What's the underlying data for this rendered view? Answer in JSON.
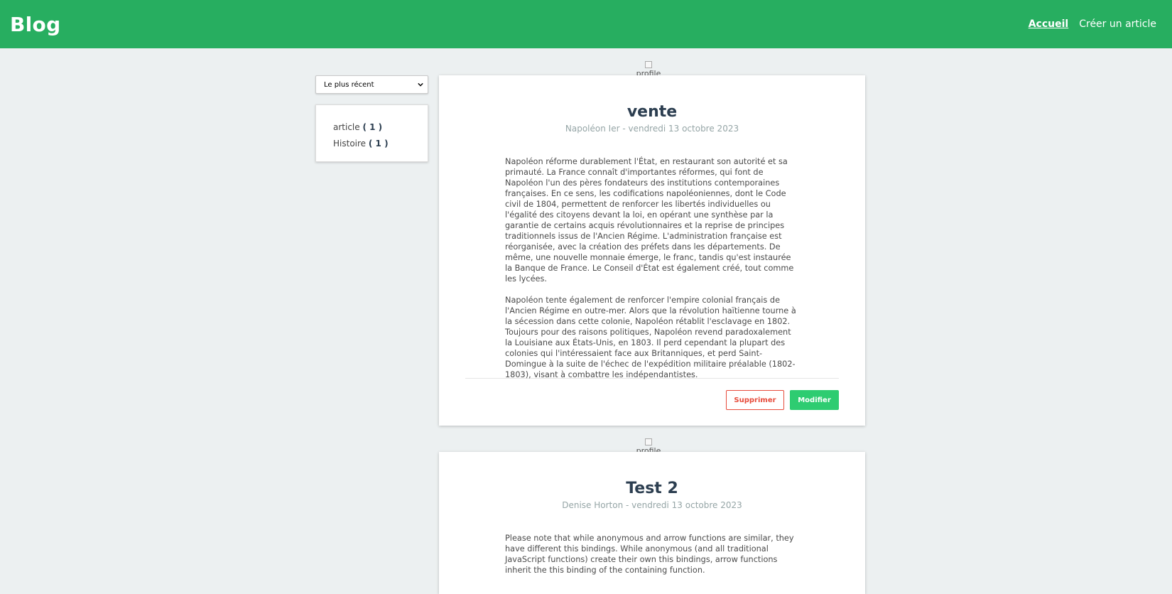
{
  "header": {
    "brand": "Blog",
    "nav": [
      {
        "label": "Accueil"
      },
      {
        "label": "Créer un article"
      }
    ]
  },
  "sort": {
    "selected": "Le plus récent"
  },
  "categories": [
    {
      "name": "article",
      "count": "( 1 )"
    },
    {
      "name": "Histoire",
      "count": "( 1 )"
    }
  ],
  "avatar_alt": "profile",
  "posts": [
    {
      "title": "vente",
      "meta": "Napoléon Ier - vendredi 13 octobre 2023",
      "paragraphs": [
        "Napoléon réforme durablement l'État, en restaurant son autorité et sa primauté. La France connaît d'importantes réformes, qui font de Napoléon l'un des pères fondateurs des institutions contemporaines françaises. En ce sens, les codifications napoléoniennes, dont le Code civil de 1804, permettent de renforcer les libertés individuelles ou l'égalité des citoyens devant la loi, en opérant une synthèse par la garantie de certains acquis révolutionnaires et la reprise de principes traditionnels issus de l'Ancien Régime. L'administration française est réorganisée, avec la création des préfets dans les départements. De même, une nouvelle monnaie émerge, le franc, tandis qu'est instaurée la Banque de France. Le Conseil d'État est également créé, tout comme les lycées.",
        "Napoléon tente également de renforcer l'empire colonial français de l'Ancien Régime en outre-mer. Alors que la révolution haïtienne tourne à la sécession dans cette colonie, Napoléon rétablit l'esclavage en 1802. Toujours pour des raisons politiques, Napoléon revend paradoxalement la Louisiane aux États-Unis, en 1803. Il perd cependant la plupart des colonies qui l'intéressaient face aux Britanniques, et perd Saint-Domingue à la suite de l'échec de l'expédition militaire préalable (1802-1803), visant à combattre les indépendantistes."
      ],
      "delete_label": "Supprimer",
      "edit_label": "Modifier"
    },
    {
      "title": "Test 2",
      "meta": "Denise Horton - vendredi 13 octobre 2023",
      "paragraphs": [
        "Please note that while anonymous and arrow functions are similar, they have different this bindings. While anonymous (and all traditional JavaScript functions) create their own this bindings, arrow functions inherit the this binding of the containing function."
      ]
    }
  ]
}
